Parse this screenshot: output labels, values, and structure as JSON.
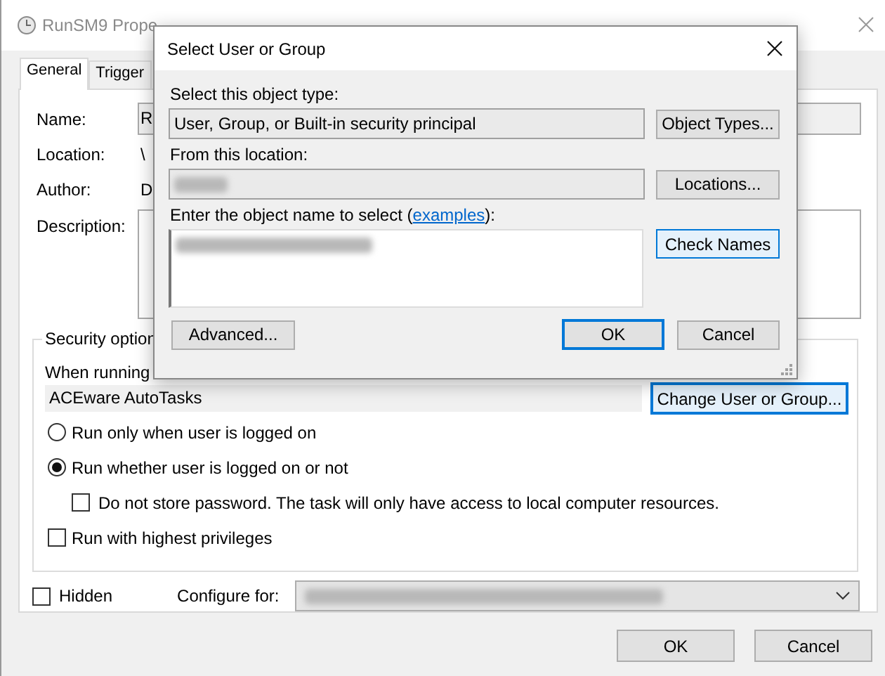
{
  "window": {
    "title": "RunSM9 Prope"
  },
  "tabs": [
    {
      "label": "General",
      "selected": true
    },
    {
      "label": "Trigger",
      "selected": false
    }
  ],
  "general": {
    "fields": [
      {
        "kind": "textbox",
        "label": "Name:",
        "value": "R"
      },
      {
        "kind": "text",
        "label": "Location:",
        "value": "\\"
      },
      {
        "kind": "text",
        "label": "Author:",
        "value": "D"
      },
      {
        "kind": "textarea",
        "label": "Description:"
      }
    ]
  },
  "security": {
    "legend": "Security option",
    "run_as_label": "When running",
    "run_as_user": "ACEware AutoTasks",
    "change_button": "Change User or Group...",
    "options": [
      {
        "kind": "radio",
        "label": "Run only when user is logged on",
        "selected": false
      },
      {
        "kind": "radio",
        "label": "Run whether user is logged on or not",
        "selected": true,
        "children": [
          {
            "kind": "checkbox",
            "label": "Do not store password.  The task will only have access to local computer resources.",
            "checked": false
          }
        ]
      },
      {
        "kind": "checkbox",
        "label": "Run with highest privileges",
        "checked": false
      }
    ]
  },
  "hidden": {
    "label": "Hidden",
    "checked": false
  },
  "configure_for": {
    "label": "Configure for:",
    "redacted": true
  },
  "buttons": [
    {
      "label": "OK"
    },
    {
      "label": "Cancel"
    }
  ],
  "dialog": {
    "title": "Select User or Group",
    "object_type_label": "Select this object type:",
    "object_type_value": "User, Group, or Built-in security principal",
    "object_types_button": "Object Types...",
    "location_label": "From this location:",
    "location_redacted": true,
    "locations_button": "Locations...",
    "name_label": "Enter the object name to select (",
    "name_link": "examples",
    "name_label_end": "):",
    "name_redacted": true,
    "check_names_button": "Check Names",
    "advanced_button": "Advanced...",
    "ok_button": "OK",
    "cancel_button": "Cancel"
  }
}
